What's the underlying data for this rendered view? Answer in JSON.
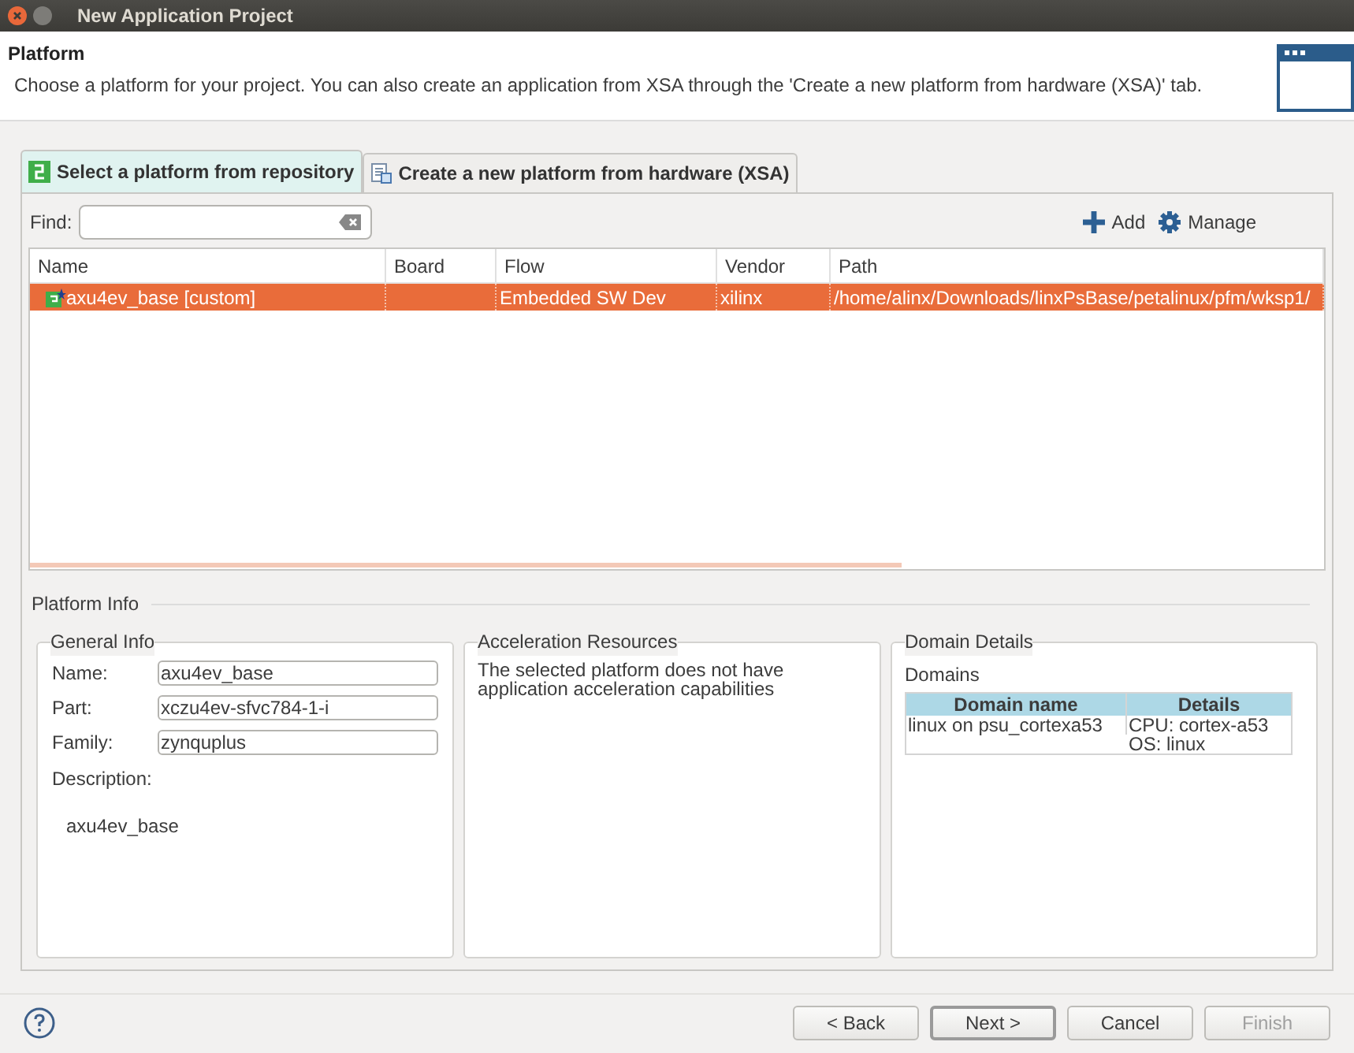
{
  "window": {
    "title": "New Application Project"
  },
  "header": {
    "title": "Platform",
    "description": "Choose a platform for your project. You can also create an application from XSA through the 'Create a new platform from hardware (XSA)' tab."
  },
  "tabs": [
    {
      "label": "Select a platform from repository",
      "selected": true
    },
    {
      "label": "Create a new platform from hardware (XSA)",
      "selected": false
    }
  ],
  "find": {
    "label": "Find:"
  },
  "toolbar": [
    "Add",
    "Manage"
  ],
  "table": {
    "columns": [
      "Name",
      "Board",
      "Flow",
      "Vendor",
      "Path"
    ],
    "rows": [
      {
        "selected": true,
        "cells": [
          "axu4ev_base [custom]",
          "",
          "Embedded SW Dev",
          "xilinx",
          "/home/alinx/Downloads/linxPsBase/petalinux/pfm/wksp1/"
        ]
      }
    ]
  },
  "platform_info": {
    "title": "Platform Info",
    "general": {
      "title": "General Info",
      "fields": [
        {
          "label": "Name:",
          "value": "axu4ev_base"
        },
        {
          "label": "Part:",
          "value": "xczu4ev-sfvc784-1-i"
        },
        {
          "label": "Family:",
          "value": "zynquplus"
        }
      ],
      "description_label": "Description:",
      "description": "axu4ev_base"
    },
    "acceleration": {
      "title": "Acceleration Resources",
      "text": "The selected platform does not have application acceleration capabilities"
    },
    "domains": {
      "title": "Domain Details",
      "label": "Domains",
      "columns": [
        "Domain name",
        "Details"
      ],
      "rows": [
        {
          "name": "linux on psu_cortexa53",
          "details": [
            "CPU: cortex-a53",
            "OS: linux"
          ]
        }
      ]
    }
  },
  "buttons": [
    {
      "label": "< Back",
      "disabled": false,
      "default": false
    },
    {
      "label": "Next >",
      "disabled": false,
      "default": true
    },
    {
      "label": "Cancel",
      "disabled": false,
      "default": false
    },
    {
      "label": "Finish",
      "disabled": true,
      "default": false
    }
  ]
}
